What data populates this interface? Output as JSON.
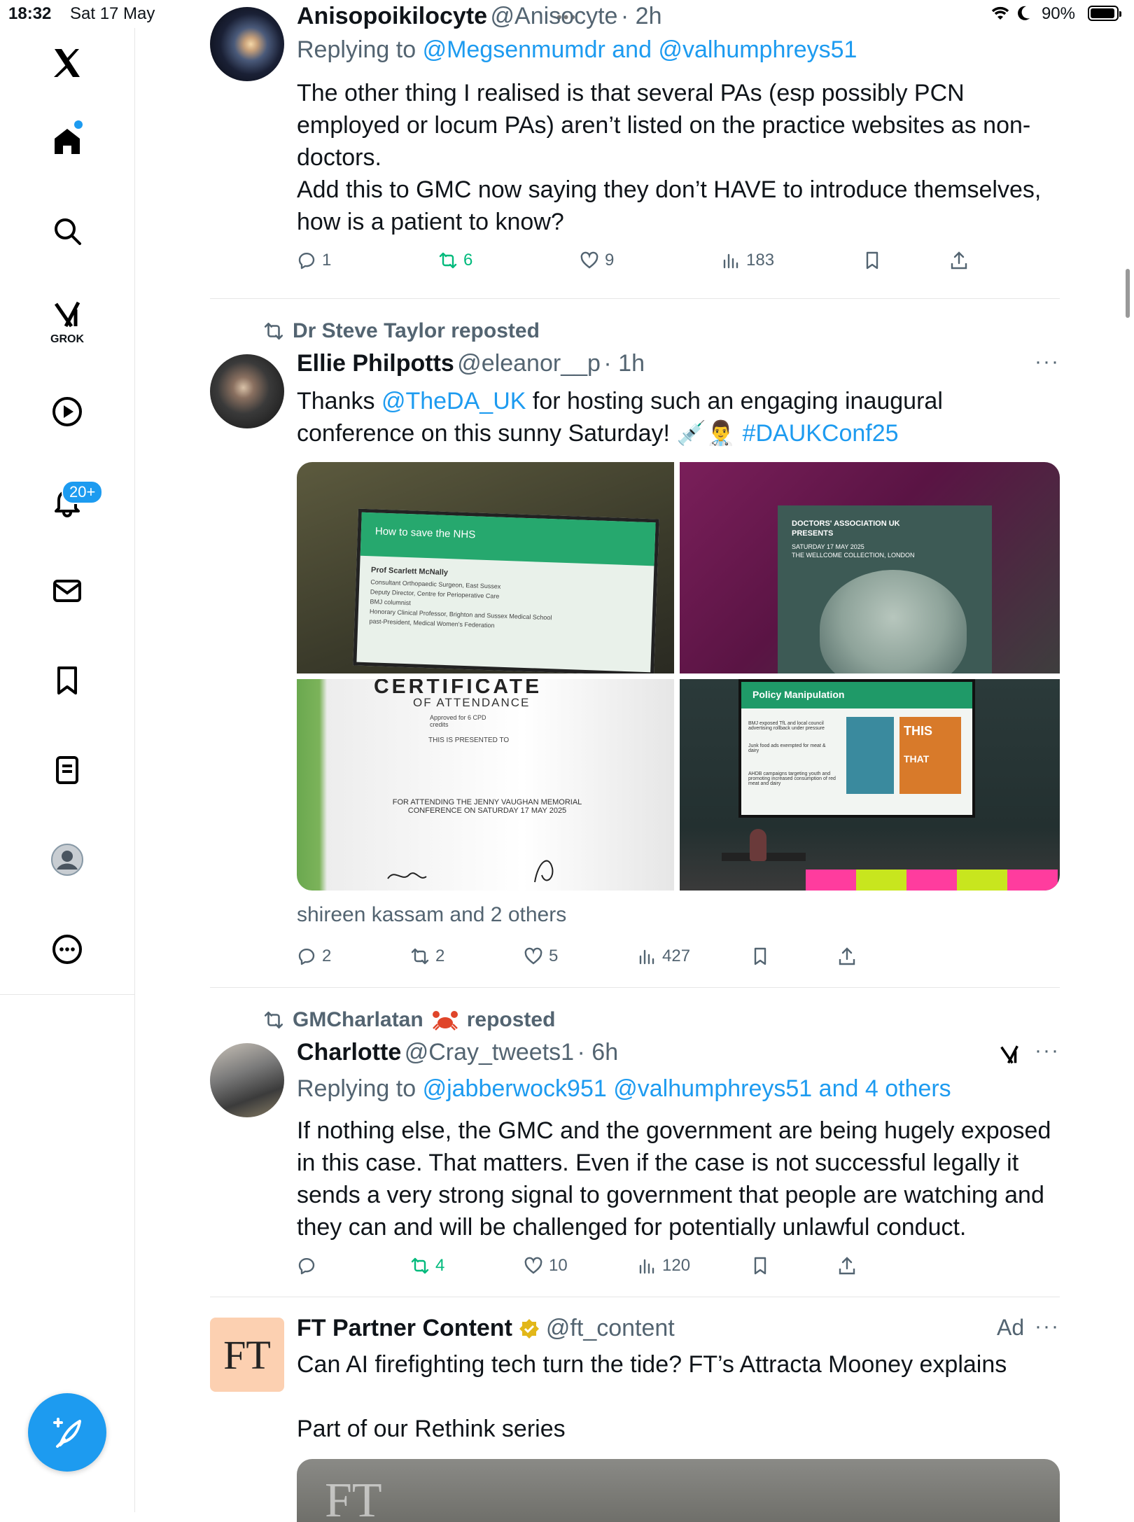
{
  "status": {
    "time": "18:32",
    "date": "Sat 17 May",
    "battery": "90%"
  },
  "nav": {
    "notifications_badge": "20+",
    "grok_label": "GROK"
  },
  "tweet1": {
    "name": "Anisopoikilocyte",
    "handle": "@Anisocyte",
    "time": "· 2h",
    "replying_prefix": "Replying to",
    "replying_to": "@Megsenmumdr and @valhumphreys51",
    "text": "The other thing I realised is that several PAs (esp possibly PCN employed or locum PAs) aren’t listed on the practice websites as non-doctors.\nAdd this to GMC now saying they don’t HAVE to introduce themselves, how is a patient to know?",
    "replies": "1",
    "reposts": "6",
    "likes": "9",
    "views": "183"
  },
  "tweet2": {
    "reposted_by": "Dr Steve Taylor reposted",
    "name": "Ellie Philpotts",
    "handle": "@eleanor__p",
    "time": "· 1h",
    "text_a": "Thanks ",
    "mention": "@TheDA_UK",
    "text_b": " for hosting such an engaging inaugural conference on this sunny Saturday! 💉👨‍⚕️ ",
    "hashtag": "#DAUKConf25",
    "images": {
      "img1_title": "How to save the NHS",
      "img1_speaker": "Prof Scarlett McNally",
      "img1_lines": [
        "Consultant Orthopaedic Surgeon, East Sussex",
        "Deputy Director, Centre for Perioperative Care",
        "BMJ columnist",
        "Honorary Clinical Professor, Brighton and Sussex Medical School",
        "past-President, Medical Women's Federation"
      ],
      "img2_line1": "DOCTORS' ASSOCIATION UK",
      "img2_line2": "PRESENTS",
      "img2_line3": "SATURDAY 17 MAY 2025",
      "img2_line4": "THE WELLCOME COLLECTION, LONDON",
      "img3_title": "CERTIFICATE",
      "img3_sub": "OF ATTENDANCE",
      "img3_cpd": "Approved for 6 CPD credits",
      "img3_presented": "THIS IS PRESENTED TO",
      "img3_for": "FOR ATTENDING THE JENNY VAUGHAN MEMORIAL CONFERENCE ON SATURDAY 17 MAY 2025",
      "img4_title": "Policy Manipulation",
      "img4_bullets": [
        "BMJ exposed TfL and local council advertising rollback under pressure",
        "Junk food ads exempted for meat & dairy",
        "AHDB campaigns targeting youth and promoting increased consumption of red meat and dairy"
      ],
      "img4_poster1": "THIS",
      "img4_poster2": "THAT"
    },
    "liked_by": "shireen kassam and 2 others",
    "replies": "2",
    "reposts": "2",
    "likes": "5",
    "views": "427"
  },
  "tweet3": {
    "reposted_by_name": "GMCharlatan",
    "reposted_by_suffix": "reposted",
    "name": "Charlotte",
    "handle": "@Cray_tweets1",
    "time": "· 6h",
    "replying_prefix": "Replying to",
    "replying_to": "@jabberwock951 @valhumphreys51 and 4 others",
    "text": "If nothing else, the GMC and the government are being hugely exposed in this case. That matters. Even if the case is not successful legally it sends a very strong signal to government that people are watching and they can and will be challenged for potentially unlawful conduct.",
    "replies": "",
    "reposts": "4",
    "likes": "10",
    "views": "120"
  },
  "tweet4": {
    "avatar_text": "FT",
    "name": "FT Partner Content",
    "handle": "@ft_content",
    "ad_label": "Ad",
    "text1": "Can AI firefighting tech turn the tide? FT’s Attracta Mooney explains",
    "text2": "Part of our Rethink series",
    "media_text": "FT"
  },
  "colors": {
    "accent": "#1d9bf0",
    "repost_green": "#00ba7c",
    "muted": "#536471",
    "ft_bg": "#fcd0b1"
  }
}
